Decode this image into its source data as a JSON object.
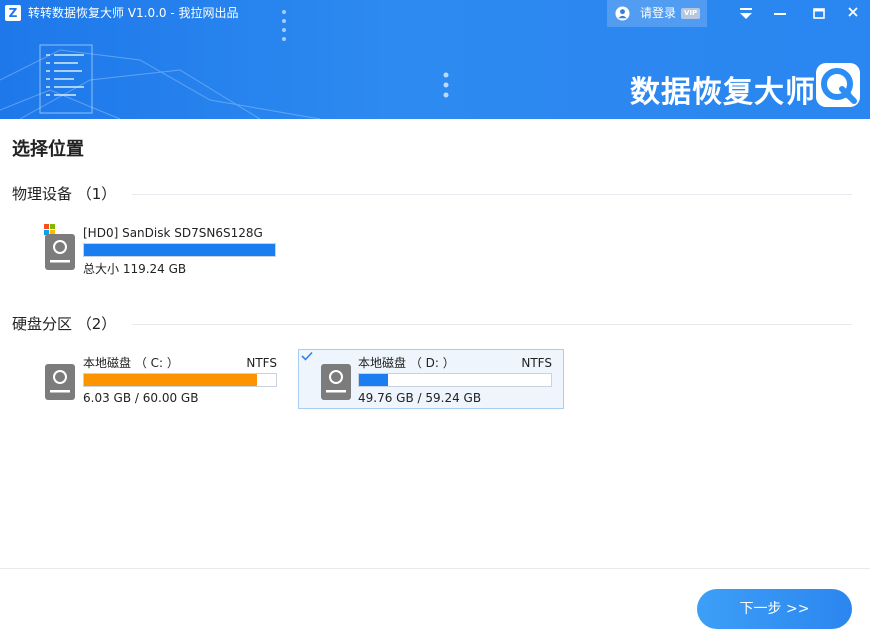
{
  "app": {
    "logo_letter": "Z",
    "title": "转转数据恢复大师 V1.0.0 - 我拉网出品",
    "login_label": "请登录",
    "vip_badge": "VIP",
    "brand_text": "数据恢复大师",
    "accent_color": "#2b86ef"
  },
  "main": {
    "section_title": "选择位置",
    "physical_group": {
      "title": "物理设备 （1）",
      "devices": [
        {
          "name": "[HD0] SanDisk SD7SN6S128G",
          "size_label": "总大小 119.24 GB",
          "fill_fraction": 1.0,
          "bar_color": "#1b7ef0",
          "has_windows_badge": true
        }
      ]
    },
    "partition_group": {
      "title": "硬盘分区 （2）",
      "partitions": [
        {
          "name": "本地磁盘 （ C: ）",
          "fs": "NTFS",
          "usage": "6.03 GB / 60.00 GB",
          "fill_fraction": 0.9,
          "bar_color": "#fb9400",
          "selected": false
        },
        {
          "name": "本地磁盘 （ D: ）",
          "fs": "NTFS",
          "usage": "49.76 GB / 59.24 GB",
          "fill_fraction": 0.15,
          "bar_color": "#1b7ef0",
          "selected": true
        }
      ]
    }
  },
  "footer": {
    "next_label": "下一步 >>"
  }
}
